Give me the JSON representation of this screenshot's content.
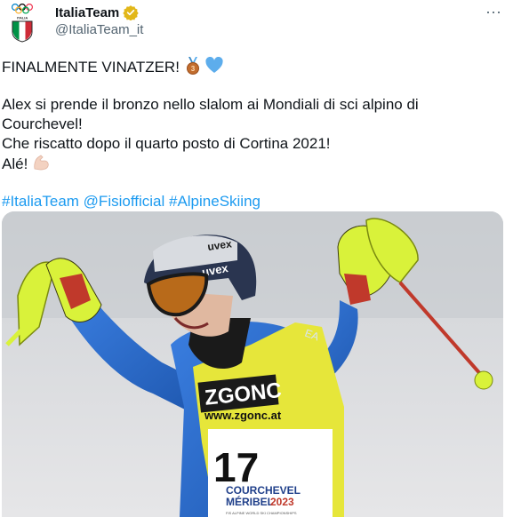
{
  "author": {
    "display_name": "ItaliaTeam",
    "handle": "@ItaliaTeam_it",
    "avatar_icon": "olympic-shield-icon",
    "verified_icon": "gold-verified-badge-icon",
    "verified_color": "#e2b719"
  },
  "more_icon": "ellipsis-icon",
  "tweet": {
    "headline": "FINALMENTE VINATZER!",
    "headline_emojis": [
      "bronze-medal-emoji",
      "blue-heart-emoji"
    ],
    "lines": [
      "Alex si prende il bronzo nello slalom ai Mondiali di sci alpino di",
      "Courchevel!",
      "Che riscatto dopo il quarto posto di Cortina 2021!",
      "Alé!"
    ],
    "trailing_emoji": "flexed-biceps-emoji",
    "hashtags": [
      "#ItaliaTeam",
      "@Fisiofficial",
      "#AlpineSkiing"
    ]
  },
  "media": {
    "description_icon": "skier-photo",
    "helmet_brand": "uvex",
    "bib_sponsor": "ZGONC",
    "bib_url": "www.zgonc.at",
    "bib_number": "17",
    "event_line1": "COURCHEVEL",
    "event_line2": "MÉRIBEL",
    "event_year": "2023",
    "event_sub": "FIS ALPINE WORLD SKI CHAMPIONSHIPS",
    "sleeve_text": "EA"
  },
  "colors": {
    "link": "#1d9bf0",
    "text": "#0f1419",
    "secondary": "#536471",
    "suit_blue": "#2f6fd0",
    "bib_yellow": "#e6e63a",
    "pole_yellow": "#d9f23a"
  }
}
